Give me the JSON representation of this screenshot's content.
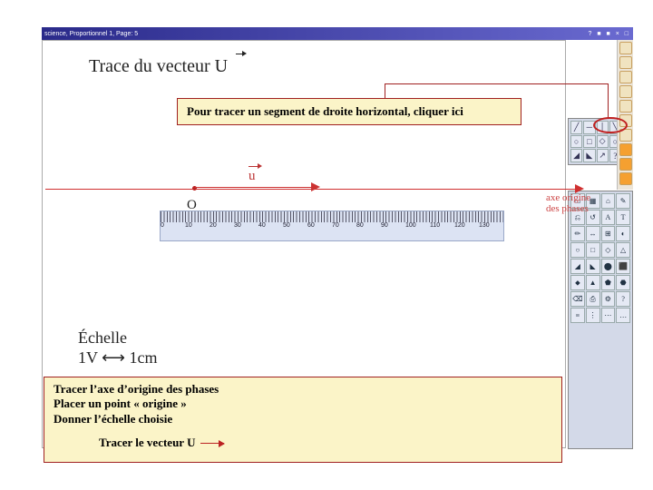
{
  "titlebar": {
    "left": "science, Proportionnel 1, Page: 5",
    "right": "? ■ ■ × □"
  },
  "hand": {
    "title": "Trace du vecteur U",
    "u": "u",
    "O": "O",
    "axis_label": "axe origine\ndes phases",
    "echelle_line1": "Échelle",
    "echelle_line2": "1V ⟷ 1cm"
  },
  "ruler": {
    "labels": [
      "0",
      "10",
      "20",
      "30",
      "40",
      "50",
      "60",
      "70",
      "80",
      "90",
      "100",
      "110",
      "120",
      "130"
    ]
  },
  "callout_top": "Pour tracer un segment de droite horizontal, cliquer ici",
  "callout_bottom": {
    "l1": "Tracer l’axe d’origine des phases",
    "l2": "Placer un point « origine »",
    "l3": "Donner l’échelle choisie",
    "l4": "Tracer le vecteur U"
  },
  "palette": {
    "cells": [
      "╱",
      "─",
      "│",
      "╲",
      "○",
      "□",
      "◇",
      "○",
      "◢",
      "◣",
      "↗",
      "?"
    ]
  },
  "sidebar_icons": [
    "▭",
    "▦",
    "⌂",
    "✎",
    "⎌",
    "↺",
    "A",
    "T",
    "✏",
    "↔",
    "⊞",
    "◐",
    "○",
    "□",
    "◇",
    "△",
    "◢",
    "◣",
    "⬤",
    "⬛",
    "⬥",
    "▲",
    "⬟",
    "⬣",
    "⌫",
    "⎙",
    "⚙",
    "?",
    "≡",
    "⋮",
    "⋯",
    "…"
  ],
  "strip_count": 10
}
